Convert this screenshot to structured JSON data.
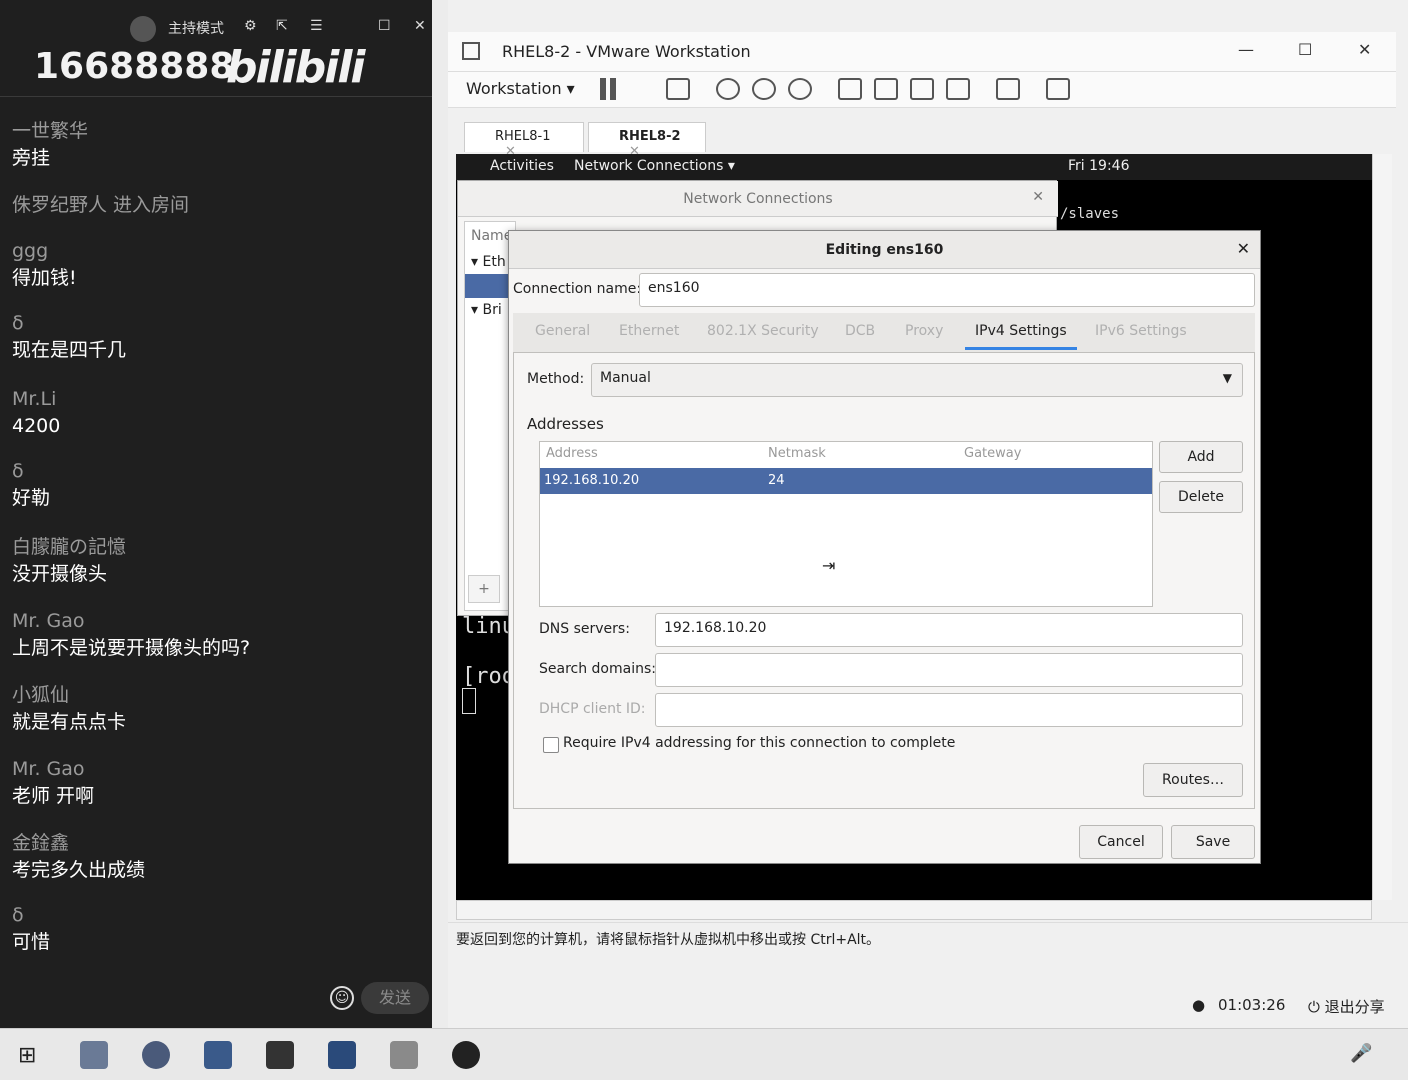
{
  "chat": {
    "header": {
      "mode_label": "主持模式"
    },
    "room_number": "16688888",
    "logo_text": "bilibili",
    "messages": [
      {
        "user": "一世繁华",
        "text": "旁挂"
      },
      {
        "user": "侏罗纪野人 进入房间",
        "text": ""
      },
      {
        "user": "ggg",
        "text": "得加钱!"
      },
      {
        "user": "δ",
        "text": "现在是四千几"
      },
      {
        "user": "Mr.Li",
        "text": "4200"
      },
      {
        "user": "δ",
        "text": "好勒"
      },
      {
        "user": "白朦朧の記憶",
        "text": "没开摄像头"
      },
      {
        "user": "Mr. Gao",
        "text": "上周不是说要开摄像头的吗?"
      },
      {
        "user": "小狐仙",
        "text": "就是有点点卡"
      },
      {
        "user": "Mr. Gao",
        "text": "老师 开啊"
      },
      {
        "user": "金鍂鑫",
        "text": "考完多久出成绩"
      },
      {
        "user": "δ",
        "text": "可惜"
      }
    ],
    "send_label": "发送"
  },
  "vmware": {
    "window_title": "RHEL8-2 - VMware Workstation",
    "menu_label": "Workstation",
    "tabs": [
      {
        "label": "RHEL8-1"
      },
      {
        "label": "RHEL8-2"
      }
    ],
    "status_text": "要返回到您的计算机，请将鼠标指针从虚拟机中移出或按 Ctrl+Alt。",
    "timer": "01:03:26",
    "exit_share": "退出分享"
  },
  "guest": {
    "activities": "Activities",
    "app_menu": "Network Connections ▾",
    "clock": "Fri 19:46",
    "terminal_frag1": "/slaves",
    "terminal_frag2": "linu",
    "terminal_frag3": "[roo"
  },
  "network_connections": {
    "title": "Network Connections",
    "list_header": "Name",
    "group1": "Eth",
    "group2": "Bri"
  },
  "edit_dialog": {
    "title": "Editing ens160",
    "connection_name_label": "Connection name:",
    "connection_name_value": "ens160",
    "tabs": [
      "General",
      "Ethernet",
      "802.1X Security",
      "DCB",
      "Proxy",
      "IPv4 Settings",
      "IPv6 Settings"
    ],
    "active_tab": "IPv4 Settings",
    "method_label": "Method:",
    "method_value": "Manual",
    "addresses_label": "Addresses",
    "columns": [
      "Address",
      "Netmask",
      "Gateway"
    ],
    "rows": [
      {
        "address": "192.168.10.20",
        "netmask": "24",
        "gateway": ""
      }
    ],
    "add_label": "Add",
    "delete_label": "Delete",
    "dns_label": "DNS servers:",
    "dns_value": "192.168.10.20",
    "search_label": "Search domains:",
    "search_value": "",
    "dhcp_label": "DHCP client ID:",
    "dhcp_value": "",
    "require_label": "Require IPv4 addressing for this connection to complete",
    "routes_label": "Routes…",
    "cancel_label": "Cancel",
    "save_label": "Save"
  }
}
